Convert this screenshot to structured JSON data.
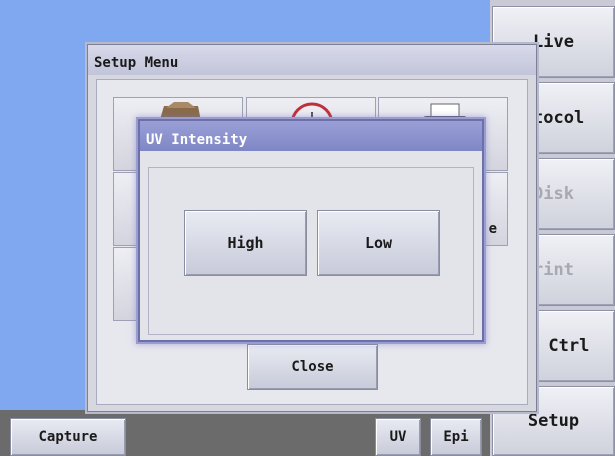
{
  "sidebar": {
    "items": [
      {
        "label": "Live",
        "enabled": true
      },
      {
        "label": "otocol",
        "enabled": true
      },
      {
        "label": "Disk",
        "enabled": false
      },
      {
        "label": "rint",
        "enabled": false
      },
      {
        "label": "el Ctrl",
        "enabled": true
      },
      {
        "label": "Setup",
        "enabled": true
      }
    ]
  },
  "bottombar": {
    "capture_label": "Capture",
    "uv_label": "UV",
    "epi_label": "Epi"
  },
  "setup_menu": {
    "title": "Setup Menu",
    "partial_label": "e",
    "close_label": "Close"
  },
  "uv_dialog": {
    "title": "UV Intensity",
    "high_label": "High",
    "low_label": "Low"
  },
  "colors": {
    "viewport": "#7fa8f0",
    "dialog_title": "#8088c8",
    "status_bar": "#6b6b6b"
  }
}
